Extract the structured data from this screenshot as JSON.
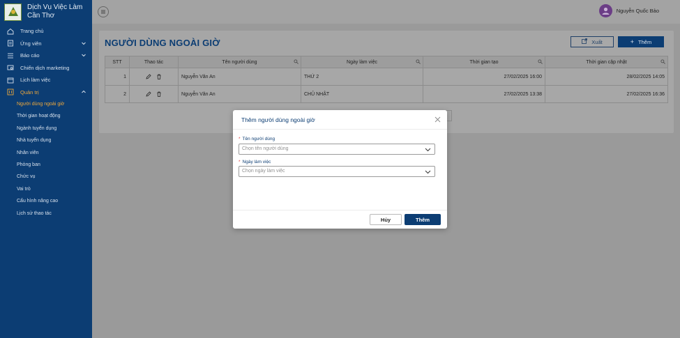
{
  "brand": {
    "line1": "Dịch Vụ Việc Làm",
    "line2": "Cần Thơ"
  },
  "nav": [
    {
      "label": "Trang chủ",
      "icon": "home-icon"
    },
    {
      "label": "Ứng viên",
      "icon": "candidate-icon",
      "expandable": true
    },
    {
      "label": "Báo cáo",
      "icon": "list-icon",
      "expandable": true
    },
    {
      "label": "Chiến dịch marketing",
      "icon": "campaign-icon"
    },
    {
      "label": "Lịch làm việc",
      "icon": "calendar-icon"
    },
    {
      "label": "Quản trị",
      "icon": "admin-icon",
      "expanded": true,
      "active": true
    }
  ],
  "subnav": [
    "Người dùng ngoài giờ",
    "Thời gian hoạt động",
    "Ngành tuyển dụng",
    "Nhà tuyển dụng",
    "Nhân viên",
    "Phòng ban",
    "Chức vụ",
    "Vai trò",
    "Cấu hình nâng cao",
    "Lịch sử thao tác"
  ],
  "topbar": {
    "user_name": "Nguyễn Quốc Bảo"
  },
  "page": {
    "title": "NGƯỜI DÙNG NGOÀI GIỜ",
    "export_label": "Xuất",
    "add_label": "Thêm"
  },
  "table": {
    "headers": {
      "stt": "STT",
      "actions": "Thao tác",
      "user": "Tên người dùng",
      "day": "Ngày làm việc",
      "created": "Thời gian tạo",
      "updated": "Thời gian cập nhật"
    },
    "rows": [
      {
        "stt": "1",
        "user": "Nguyễn Văn An",
        "day": "THỨ 2",
        "created": "27/02/2025 16:00",
        "updated": "28/02/2025 14:05"
      },
      {
        "stt": "2",
        "user": "Nguyễn Văn An",
        "day": "CHỦ NHẬT",
        "created": "27/02/2025 13:38",
        "updated": "27/02/2025 16:36"
      }
    ]
  },
  "modal": {
    "title": "Thêm người dùng ngoài giờ",
    "user_label": "Tên người dùng",
    "user_placeholder": "Chọn tên người dùng",
    "day_label": "Ngày làm việc",
    "day_placeholder": "Chọn ngày làm việc",
    "cancel_label": "Hủy",
    "submit_label": "Thêm"
  },
  "colors": {
    "primary": "#0c3d73",
    "accent": "#f0a93b",
    "required": "#e03a3a"
  }
}
